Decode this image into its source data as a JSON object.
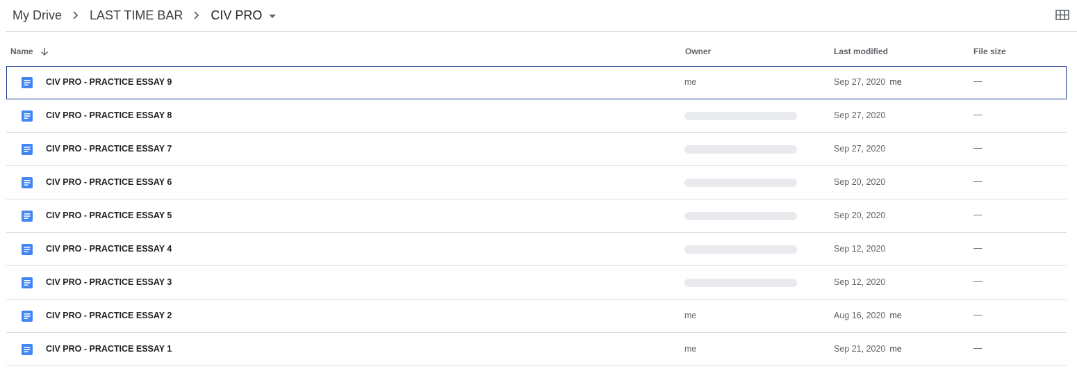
{
  "breadcrumb": {
    "items": [
      "My Drive",
      "LAST TIME BAR"
    ],
    "current": "CIV PRO"
  },
  "columns": {
    "name": "Name",
    "owner": "Owner",
    "last_modified": "Last modified",
    "file_size": "File size"
  },
  "colors": {
    "doc_icon": "#4285f4",
    "selected_border": "#1a3d8a",
    "owner_placeholder": "#e8eaed"
  },
  "files": [
    {
      "name": "CIV PRO - PRACTICE ESSAY 9",
      "owner": "me",
      "modified": "Sep 27, 2020",
      "modified_by": "me",
      "size": "—",
      "selected": true
    },
    {
      "name": "CIV PRO - PRACTICE ESSAY 8",
      "owner": "",
      "modified": "Sep 27, 2020",
      "modified_by": "",
      "size": "—"
    },
    {
      "name": "CIV PRO - PRACTICE ESSAY 7",
      "owner": "",
      "modified": "Sep 27, 2020",
      "modified_by": "",
      "size": "—"
    },
    {
      "name": "CIV PRO - PRACTICE ESSAY 6",
      "owner": "",
      "modified": "Sep 20, 2020",
      "modified_by": "",
      "size": "—"
    },
    {
      "name": "CIV PRO - PRACTICE ESSAY 5",
      "owner": "",
      "modified": "Sep 20, 2020",
      "modified_by": "",
      "size": "—"
    },
    {
      "name": "CIV PRO - PRACTICE ESSAY 4",
      "owner": "",
      "modified": "Sep 12, 2020",
      "modified_by": "",
      "size": "—"
    },
    {
      "name": "CIV PRO - PRACTICE ESSAY 3",
      "owner": "",
      "modified": "Sep 12, 2020",
      "modified_by": "",
      "size": "—"
    },
    {
      "name": "CIV PRO - PRACTICE ESSAY 2",
      "owner": "me",
      "modified": "Aug 16, 2020",
      "modified_by": "me",
      "size": "—"
    },
    {
      "name": "CIV PRO - PRACTICE ESSAY 1",
      "owner": "me",
      "modified": "Sep 21, 2020",
      "modified_by": "me",
      "size": "—"
    }
  ]
}
